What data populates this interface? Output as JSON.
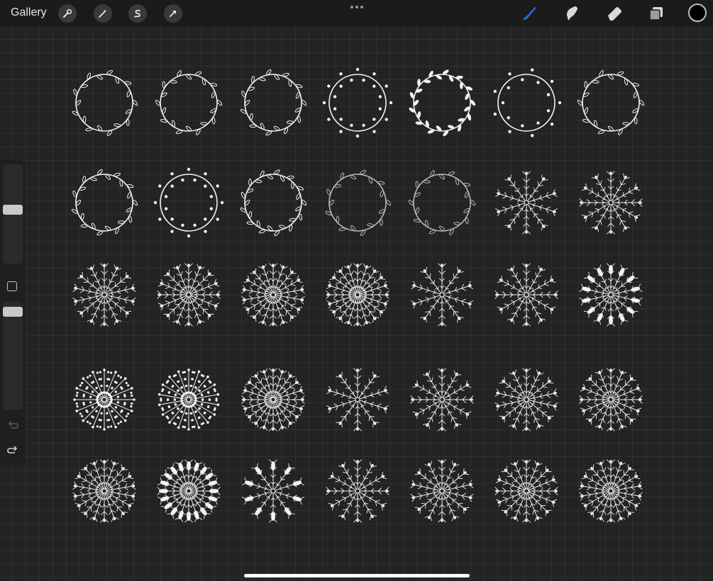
{
  "topbar": {
    "gallery_label": "Gallery",
    "actions": [
      "wrench-icon",
      "adjustments-wand-icon",
      "selection-s-icon",
      "transform-arrow-icon"
    ],
    "tools": [
      "brush-icon",
      "smudge-icon",
      "eraser-icon",
      "layers-icon"
    ],
    "active_tool": "brush-icon",
    "accent_color": "#1e6fe0",
    "current_color": "#000000"
  },
  "sidebar": {
    "brush_size_level": 0.55,
    "opacity_level": 0.95,
    "buttons": [
      "modify-square-icon",
      "undo-icon",
      "redo-icon"
    ]
  },
  "canvas": {
    "rows": [
      [
        "wreath-leafy-loose",
        "wreath-leaf-sprig",
        "wreath-dense-leaf",
        "wreath-berry",
        "wreath-bold-leaf",
        "wreath-dot-berry",
        "wreath-thin-leaf"
      ],
      [
        "wreath-fern",
        "wreath-sprig-berry",
        "wreath-fern-open",
        "wreath-floral-sketch",
        "wreath-floral-dense",
        "mandala-fern-radial",
        "mandala-leaf-chevron"
      ],
      [
        "mandala-swirl",
        "mandala-flower-ring",
        "mandala-eucalyptus",
        "mandala-snowflake-fern",
        "mandala-spoke-leaf",
        "mandala-dense-fern",
        "mandala-big-leaf"
      ],
      [
        "mandala-dot-ring",
        "mandala-berry-cluster",
        "mandala-burst-leaf",
        "mandala-sprig-star",
        "mandala-fine-spoke",
        "mandala-flower-scallop",
        "mandala-lace"
      ],
      [
        "mandala-fern-cross",
        "mandala-petal-dense",
        "mandala-bold-leaf",
        "mandala-fine-fern",
        "mandala-chevron-star",
        "mandala-curl-ring",
        "mandala-leaf-cross"
      ]
    ]
  }
}
